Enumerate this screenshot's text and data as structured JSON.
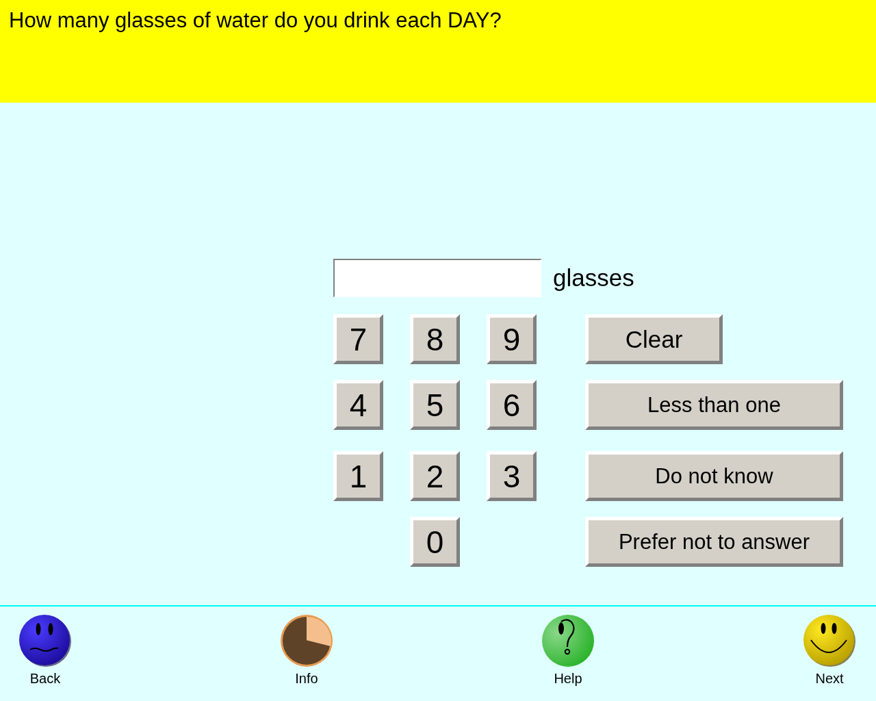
{
  "question": "How many glasses of water do you drink each DAY?",
  "answer": {
    "unit": "glasses"
  },
  "keypad": {
    "rows": [
      [
        "7",
        "8",
        "9"
      ],
      [
        "4",
        "5",
        "6"
      ],
      [
        "1",
        "2",
        "3"
      ],
      [
        "",
        "0",
        ""
      ]
    ]
  },
  "side_buttons": [
    {
      "kind": "clear",
      "label": "Clear"
    },
    {
      "kind": "option",
      "label": "Less than one"
    },
    {
      "kind": "option",
      "label": "Do not know"
    },
    {
      "kind": "option",
      "label": "Prefer not to answer"
    }
  ],
  "navigation": [
    {
      "kind": "back",
      "label": "Back"
    },
    {
      "kind": "info",
      "label": "Info"
    },
    {
      "kind": "help",
      "label": "Help"
    },
    {
      "kind": "next",
      "label": "Next"
    }
  ]
}
